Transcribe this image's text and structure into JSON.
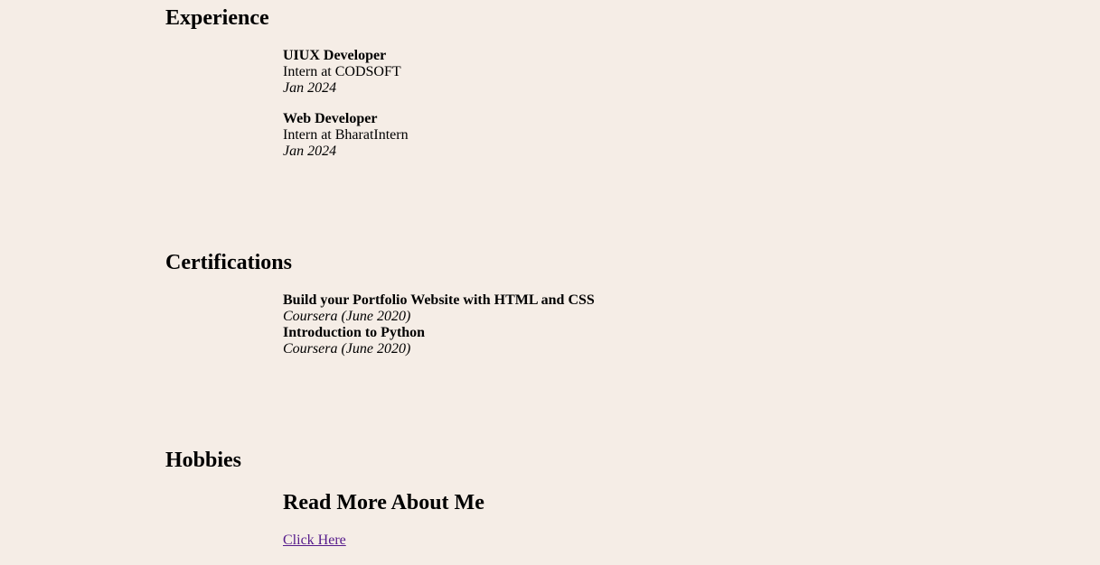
{
  "experience": {
    "heading": "Experience",
    "items": [
      {
        "title": "UIUX Developer",
        "org": "Intern at CODSOFT",
        "date": "Jan 2024"
      },
      {
        "title": "Web Developer",
        "org": "Intern at BharatIntern",
        "date": "Jan 2024"
      }
    ]
  },
  "certifications": {
    "heading": "Certifications",
    "items": [
      {
        "title": "Build your Portfolio Website with HTML and CSS",
        "issuer": "Coursera (June 2020)"
      },
      {
        "title": "Introduction to Python",
        "issuer": "Coursera (June 2020)"
      }
    ]
  },
  "hobbies": {
    "heading": "Hobbies",
    "subheading": "Read More About Me",
    "link": "Click Here"
  },
  "colors": {
    "background": "#f5ede6",
    "link": "#551a8b"
  }
}
